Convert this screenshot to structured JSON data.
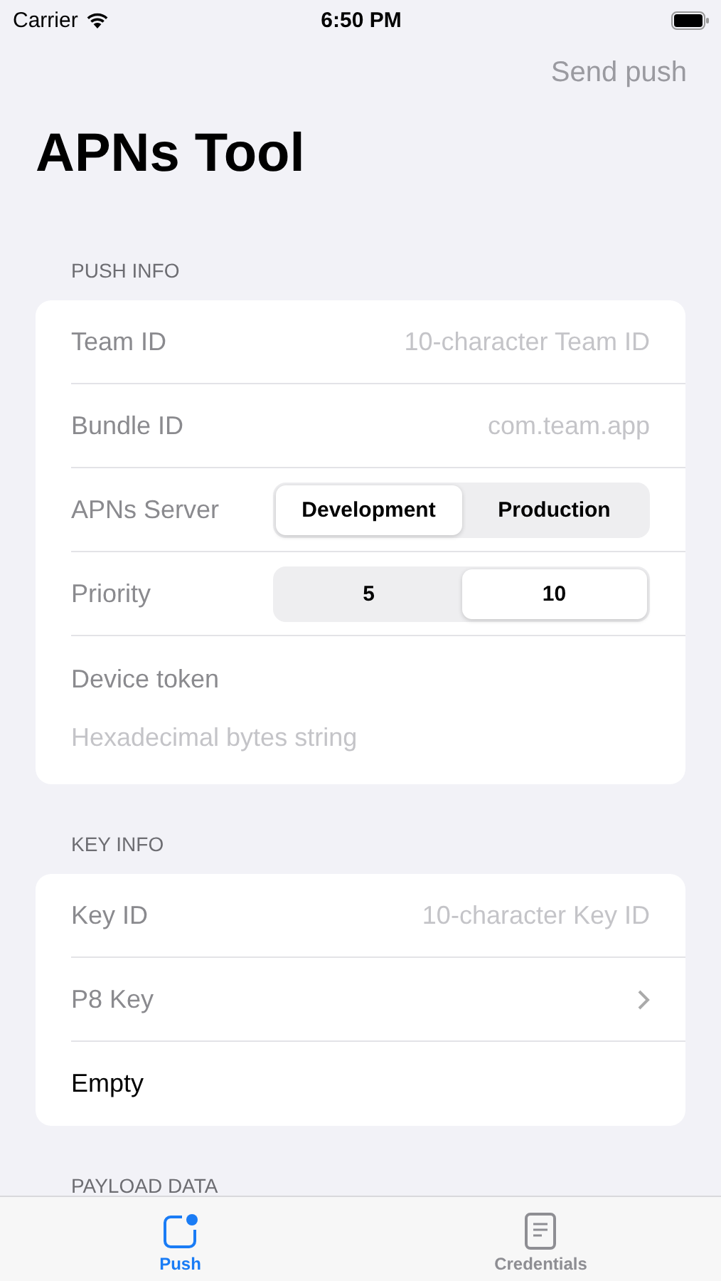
{
  "status_bar": {
    "carrier": "Carrier",
    "time": "6:50 PM"
  },
  "nav": {
    "action": "Send push",
    "action_disabled": true,
    "title": "APNs Tool"
  },
  "sections": [
    {
      "header": "PUSH INFO",
      "rows": [
        {
          "kind": "field",
          "label": "Team ID",
          "placeholder": "10-character Team ID"
        },
        {
          "kind": "field",
          "label": "Bundle ID",
          "placeholder": "com.team.app"
        },
        {
          "kind": "segmented",
          "label": "APNs Server",
          "options": [
            {
              "label": "Development",
              "selected": true
            },
            {
              "label": "Production",
              "selected": false
            }
          ]
        },
        {
          "kind": "segmented",
          "label": "Priority",
          "options": [
            {
              "label": "5",
              "selected": false
            },
            {
              "label": "10",
              "selected": true
            }
          ]
        },
        {
          "kind": "token",
          "label": "Device token",
          "placeholder": "Hexadecimal bytes string"
        }
      ]
    },
    {
      "header": "KEY INFO",
      "rows": [
        {
          "kind": "field",
          "label": "Key ID",
          "placeholder": "10-character Key ID"
        },
        {
          "kind": "disclosure",
          "label": "P8 Key"
        },
        {
          "kind": "value",
          "label": "Empty"
        }
      ]
    },
    {
      "header": "PAYLOAD DATA"
    }
  ],
  "tab_bar": [
    {
      "label": "Push",
      "selected": true
    },
    {
      "label": "Credentials",
      "selected": false
    }
  ]
}
